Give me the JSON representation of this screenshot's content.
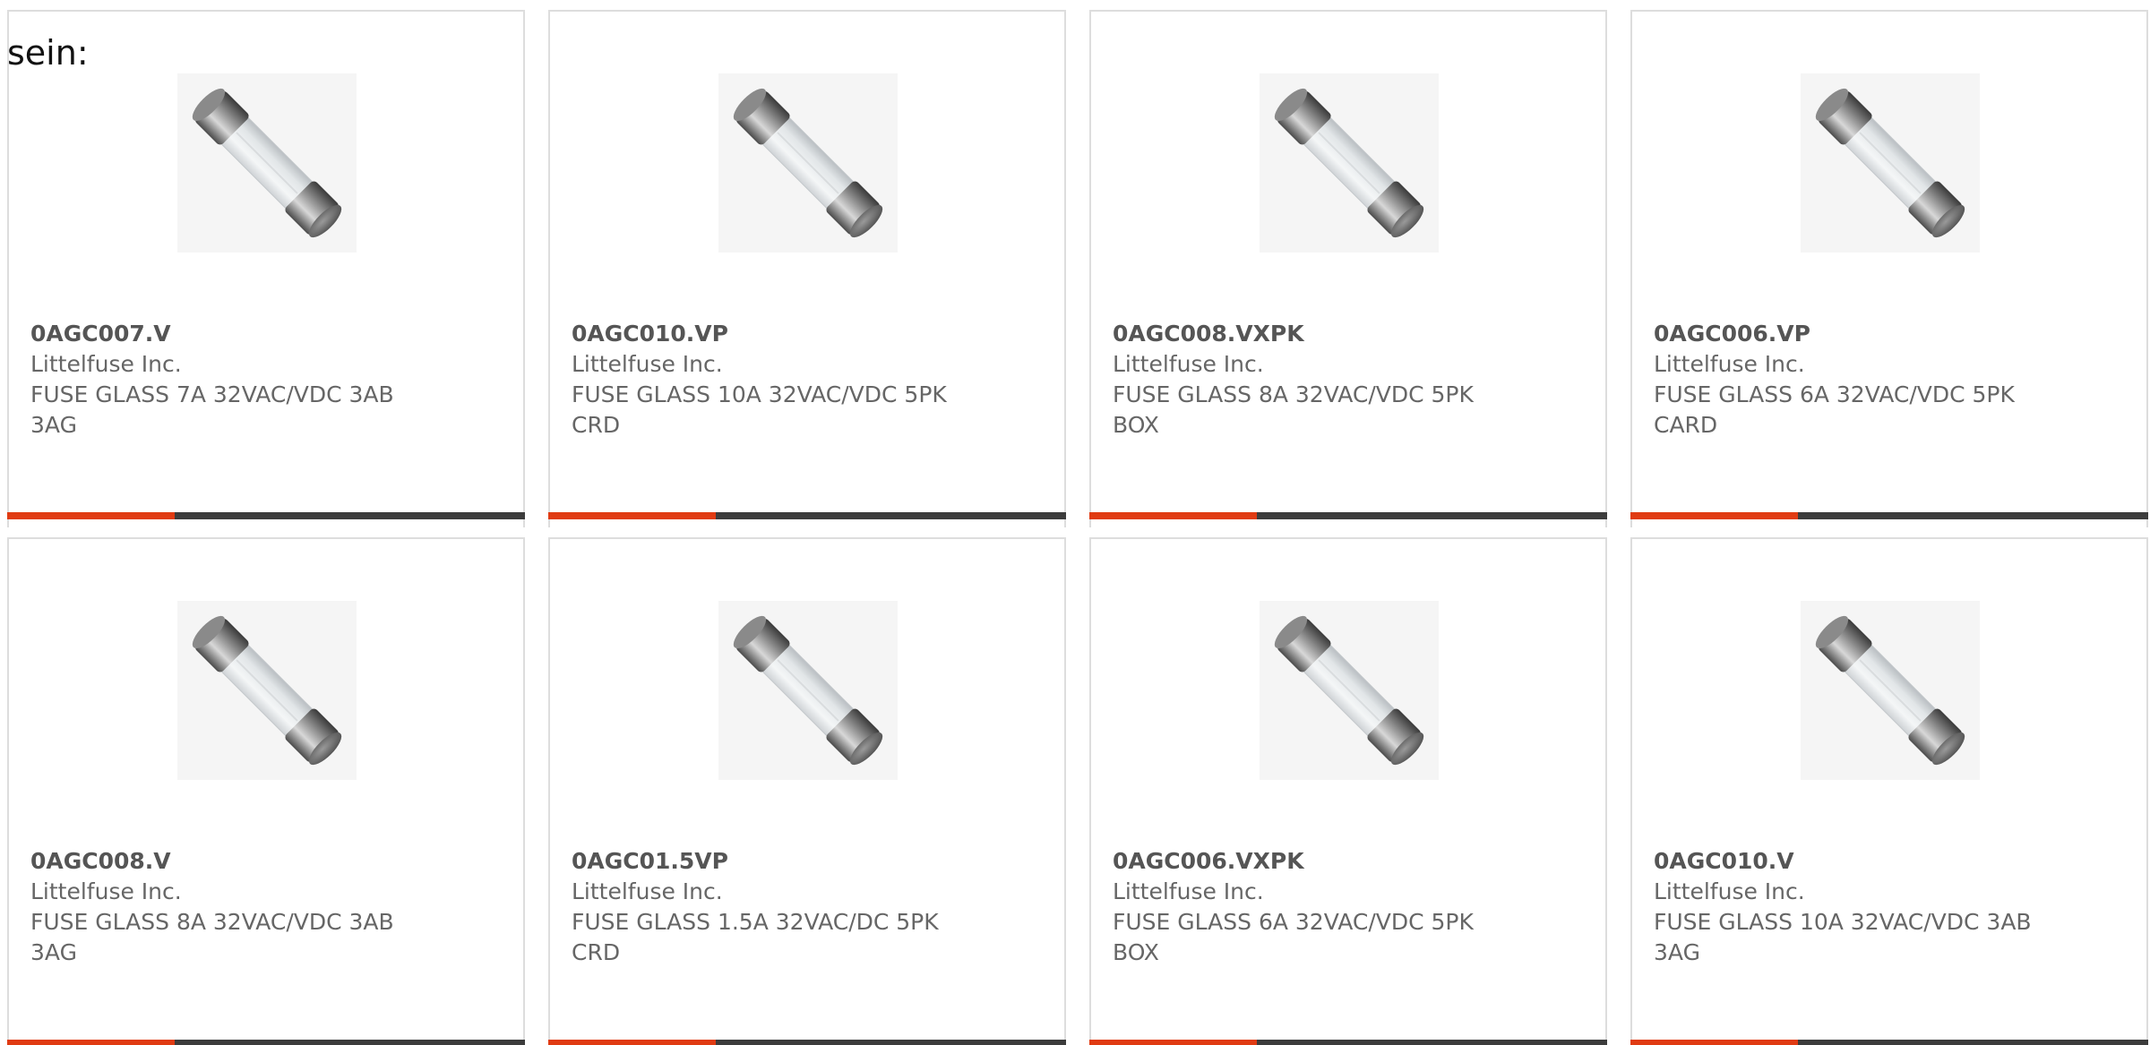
{
  "intro_text": "sein:",
  "colors": {
    "accent": "#e03b12",
    "bar": "#3c3c3c",
    "border": "#dddddd",
    "text": "#666666"
  },
  "products": [
    {
      "part_number": "0AGC007.V",
      "manufacturer": "Littelfuse Inc.",
      "description": "FUSE GLASS 7A 32VAC/VDC 3AB 3AG",
      "icon": "glass-fuse-icon"
    },
    {
      "part_number": "0AGC010.VP",
      "manufacturer": "Littelfuse Inc.",
      "description": "FUSE GLASS 10A 32VAC/VDC 5PK CRD",
      "icon": "glass-fuse-icon"
    },
    {
      "part_number": "0AGC008.VXPK",
      "manufacturer": "Littelfuse Inc.",
      "description": "FUSE GLASS 8A 32VAC/VDC 5PK BOX",
      "icon": "glass-fuse-icon"
    },
    {
      "part_number": "0AGC006.VP",
      "manufacturer": "Littelfuse Inc.",
      "description": "FUSE GLASS 6A 32VAC/VDC 5PK CARD",
      "icon": "glass-fuse-icon"
    },
    {
      "part_number": "0AGC008.V",
      "manufacturer": "Littelfuse Inc.",
      "description": "FUSE GLASS 8A 32VAC/VDC 3AB 3AG",
      "icon": "glass-fuse-icon"
    },
    {
      "part_number": "0AGC01.5VP",
      "manufacturer": "Littelfuse Inc.",
      "description": "FUSE GLASS 1.5A 32VAC/DC 5PK CRD",
      "icon": "glass-fuse-icon"
    },
    {
      "part_number": "0AGC006.VXPK",
      "manufacturer": "Littelfuse Inc.",
      "description": "FUSE GLASS 6A 32VAC/VDC 5PK BOX",
      "icon": "glass-fuse-icon"
    },
    {
      "part_number": "0AGC010.V",
      "manufacturer": "Littelfuse Inc.",
      "description": "FUSE GLASS 10A 32VAC/VDC 3AB 3AG",
      "icon": "glass-fuse-icon"
    }
  ]
}
